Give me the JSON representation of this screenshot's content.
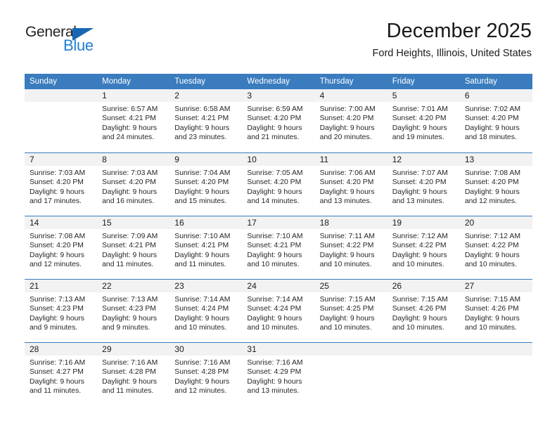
{
  "logo": {
    "word_one": "General",
    "word_two": "Blue",
    "triangle_color": "#1567b4",
    "blue_text_color": "#1f7fd4"
  },
  "header": {
    "title": "December 2025",
    "subtitle": "Ford Heights, Illinois, United States"
  },
  "theme": {
    "header_blue": "#3a7cbe",
    "daynum_bg": "#f2f2f2",
    "text": "#1a1a1a"
  },
  "weekday_headers": [
    "Sunday",
    "Monday",
    "Tuesday",
    "Wednesday",
    "Thursday",
    "Friday",
    "Saturday"
  ],
  "weeks": [
    [
      {
        "day": "",
        "sunrise": "",
        "sunset": "",
        "daylight_line1": "",
        "daylight_line2": ""
      },
      {
        "day": "1",
        "sunrise": "Sunrise: 6:57 AM",
        "sunset": "Sunset: 4:21 PM",
        "daylight_line1": "Daylight: 9 hours",
        "daylight_line2": "and 24 minutes."
      },
      {
        "day": "2",
        "sunrise": "Sunrise: 6:58 AM",
        "sunset": "Sunset: 4:21 PM",
        "daylight_line1": "Daylight: 9 hours",
        "daylight_line2": "and 23 minutes."
      },
      {
        "day": "3",
        "sunrise": "Sunrise: 6:59 AM",
        "sunset": "Sunset: 4:20 PM",
        "daylight_line1": "Daylight: 9 hours",
        "daylight_line2": "and 21 minutes."
      },
      {
        "day": "4",
        "sunrise": "Sunrise: 7:00 AM",
        "sunset": "Sunset: 4:20 PM",
        "daylight_line1": "Daylight: 9 hours",
        "daylight_line2": "and 20 minutes."
      },
      {
        "day": "5",
        "sunrise": "Sunrise: 7:01 AM",
        "sunset": "Sunset: 4:20 PM",
        "daylight_line1": "Daylight: 9 hours",
        "daylight_line2": "and 19 minutes."
      },
      {
        "day": "6",
        "sunrise": "Sunrise: 7:02 AM",
        "sunset": "Sunset: 4:20 PM",
        "daylight_line1": "Daylight: 9 hours",
        "daylight_line2": "and 18 minutes."
      }
    ],
    [
      {
        "day": "7",
        "sunrise": "Sunrise: 7:03 AM",
        "sunset": "Sunset: 4:20 PM",
        "daylight_line1": "Daylight: 9 hours",
        "daylight_line2": "and 17 minutes."
      },
      {
        "day": "8",
        "sunrise": "Sunrise: 7:03 AM",
        "sunset": "Sunset: 4:20 PM",
        "daylight_line1": "Daylight: 9 hours",
        "daylight_line2": "and 16 minutes."
      },
      {
        "day": "9",
        "sunrise": "Sunrise: 7:04 AM",
        "sunset": "Sunset: 4:20 PM",
        "daylight_line1": "Daylight: 9 hours",
        "daylight_line2": "and 15 minutes."
      },
      {
        "day": "10",
        "sunrise": "Sunrise: 7:05 AM",
        "sunset": "Sunset: 4:20 PM",
        "daylight_line1": "Daylight: 9 hours",
        "daylight_line2": "and 14 minutes."
      },
      {
        "day": "11",
        "sunrise": "Sunrise: 7:06 AM",
        "sunset": "Sunset: 4:20 PM",
        "daylight_line1": "Daylight: 9 hours",
        "daylight_line2": "and 13 minutes."
      },
      {
        "day": "12",
        "sunrise": "Sunrise: 7:07 AM",
        "sunset": "Sunset: 4:20 PM",
        "daylight_line1": "Daylight: 9 hours",
        "daylight_line2": "and 13 minutes."
      },
      {
        "day": "13",
        "sunrise": "Sunrise: 7:08 AM",
        "sunset": "Sunset: 4:20 PM",
        "daylight_line1": "Daylight: 9 hours",
        "daylight_line2": "and 12 minutes."
      }
    ],
    [
      {
        "day": "14",
        "sunrise": "Sunrise: 7:08 AM",
        "sunset": "Sunset: 4:20 PM",
        "daylight_line1": "Daylight: 9 hours",
        "daylight_line2": "and 12 minutes."
      },
      {
        "day": "15",
        "sunrise": "Sunrise: 7:09 AM",
        "sunset": "Sunset: 4:21 PM",
        "daylight_line1": "Daylight: 9 hours",
        "daylight_line2": "and 11 minutes."
      },
      {
        "day": "16",
        "sunrise": "Sunrise: 7:10 AM",
        "sunset": "Sunset: 4:21 PM",
        "daylight_line1": "Daylight: 9 hours",
        "daylight_line2": "and 11 minutes."
      },
      {
        "day": "17",
        "sunrise": "Sunrise: 7:10 AM",
        "sunset": "Sunset: 4:21 PM",
        "daylight_line1": "Daylight: 9 hours",
        "daylight_line2": "and 10 minutes."
      },
      {
        "day": "18",
        "sunrise": "Sunrise: 7:11 AM",
        "sunset": "Sunset: 4:22 PM",
        "daylight_line1": "Daylight: 9 hours",
        "daylight_line2": "and 10 minutes."
      },
      {
        "day": "19",
        "sunrise": "Sunrise: 7:12 AM",
        "sunset": "Sunset: 4:22 PM",
        "daylight_line1": "Daylight: 9 hours",
        "daylight_line2": "and 10 minutes."
      },
      {
        "day": "20",
        "sunrise": "Sunrise: 7:12 AM",
        "sunset": "Sunset: 4:22 PM",
        "daylight_line1": "Daylight: 9 hours",
        "daylight_line2": "and 10 minutes."
      }
    ],
    [
      {
        "day": "21",
        "sunrise": "Sunrise: 7:13 AM",
        "sunset": "Sunset: 4:23 PM",
        "daylight_line1": "Daylight: 9 hours",
        "daylight_line2": "and 9 minutes."
      },
      {
        "day": "22",
        "sunrise": "Sunrise: 7:13 AM",
        "sunset": "Sunset: 4:23 PM",
        "daylight_line1": "Daylight: 9 hours",
        "daylight_line2": "and 9 minutes."
      },
      {
        "day": "23",
        "sunrise": "Sunrise: 7:14 AM",
        "sunset": "Sunset: 4:24 PM",
        "daylight_line1": "Daylight: 9 hours",
        "daylight_line2": "and 10 minutes."
      },
      {
        "day": "24",
        "sunrise": "Sunrise: 7:14 AM",
        "sunset": "Sunset: 4:24 PM",
        "daylight_line1": "Daylight: 9 hours",
        "daylight_line2": "and 10 minutes."
      },
      {
        "day": "25",
        "sunrise": "Sunrise: 7:15 AM",
        "sunset": "Sunset: 4:25 PM",
        "daylight_line1": "Daylight: 9 hours",
        "daylight_line2": "and 10 minutes."
      },
      {
        "day": "26",
        "sunrise": "Sunrise: 7:15 AM",
        "sunset": "Sunset: 4:26 PM",
        "daylight_line1": "Daylight: 9 hours",
        "daylight_line2": "and 10 minutes."
      },
      {
        "day": "27",
        "sunrise": "Sunrise: 7:15 AM",
        "sunset": "Sunset: 4:26 PM",
        "daylight_line1": "Daylight: 9 hours",
        "daylight_line2": "and 10 minutes."
      }
    ],
    [
      {
        "day": "28",
        "sunrise": "Sunrise: 7:16 AM",
        "sunset": "Sunset: 4:27 PM",
        "daylight_line1": "Daylight: 9 hours",
        "daylight_line2": "and 11 minutes."
      },
      {
        "day": "29",
        "sunrise": "Sunrise: 7:16 AM",
        "sunset": "Sunset: 4:28 PM",
        "daylight_line1": "Daylight: 9 hours",
        "daylight_line2": "and 11 minutes."
      },
      {
        "day": "30",
        "sunrise": "Sunrise: 7:16 AM",
        "sunset": "Sunset: 4:28 PM",
        "daylight_line1": "Daylight: 9 hours",
        "daylight_line2": "and 12 minutes."
      },
      {
        "day": "31",
        "sunrise": "Sunrise: 7:16 AM",
        "sunset": "Sunset: 4:29 PM",
        "daylight_line1": "Daylight: 9 hours",
        "daylight_line2": "and 13 minutes."
      },
      {
        "day": "",
        "sunrise": "",
        "sunset": "",
        "daylight_line1": "",
        "daylight_line2": ""
      },
      {
        "day": "",
        "sunrise": "",
        "sunset": "",
        "daylight_line1": "",
        "daylight_line2": ""
      },
      {
        "day": "",
        "sunrise": "",
        "sunset": "",
        "daylight_line1": "",
        "daylight_line2": ""
      }
    ]
  ]
}
